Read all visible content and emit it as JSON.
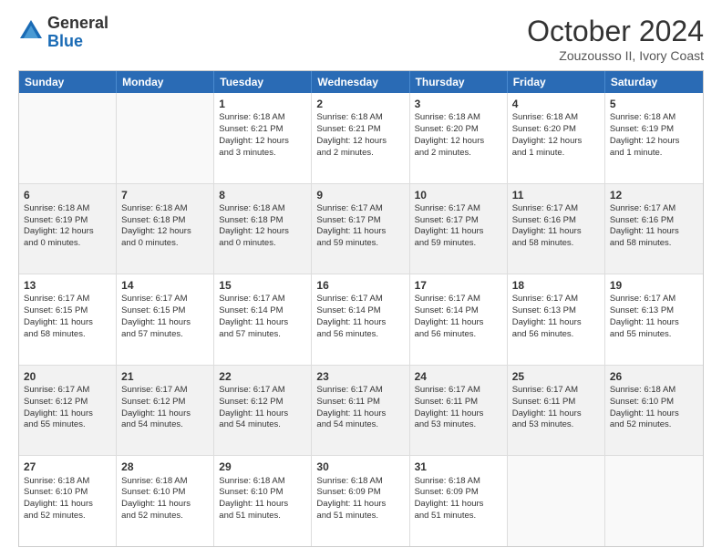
{
  "logo": {
    "general": "General",
    "blue": "Blue"
  },
  "title": "October 2024",
  "location": "Zouzousso II, Ivory Coast",
  "headers": [
    "Sunday",
    "Monday",
    "Tuesday",
    "Wednesday",
    "Thursday",
    "Friday",
    "Saturday"
  ],
  "weeks": [
    [
      {
        "day": "",
        "info": ""
      },
      {
        "day": "",
        "info": ""
      },
      {
        "day": "1",
        "info": "Sunrise: 6:18 AM\nSunset: 6:21 PM\nDaylight: 12 hours\nand 3 minutes."
      },
      {
        "day": "2",
        "info": "Sunrise: 6:18 AM\nSunset: 6:21 PM\nDaylight: 12 hours\nand 2 minutes."
      },
      {
        "day": "3",
        "info": "Sunrise: 6:18 AM\nSunset: 6:20 PM\nDaylight: 12 hours\nand 2 minutes."
      },
      {
        "day": "4",
        "info": "Sunrise: 6:18 AM\nSunset: 6:20 PM\nDaylight: 12 hours\nand 1 minute."
      },
      {
        "day": "5",
        "info": "Sunrise: 6:18 AM\nSunset: 6:19 PM\nDaylight: 12 hours\nand 1 minute."
      }
    ],
    [
      {
        "day": "6",
        "info": "Sunrise: 6:18 AM\nSunset: 6:19 PM\nDaylight: 12 hours\nand 0 minutes."
      },
      {
        "day": "7",
        "info": "Sunrise: 6:18 AM\nSunset: 6:18 PM\nDaylight: 12 hours\nand 0 minutes."
      },
      {
        "day": "8",
        "info": "Sunrise: 6:18 AM\nSunset: 6:18 PM\nDaylight: 12 hours\nand 0 minutes."
      },
      {
        "day": "9",
        "info": "Sunrise: 6:17 AM\nSunset: 6:17 PM\nDaylight: 11 hours\nand 59 minutes."
      },
      {
        "day": "10",
        "info": "Sunrise: 6:17 AM\nSunset: 6:17 PM\nDaylight: 11 hours\nand 59 minutes."
      },
      {
        "day": "11",
        "info": "Sunrise: 6:17 AM\nSunset: 6:16 PM\nDaylight: 11 hours\nand 58 minutes."
      },
      {
        "day": "12",
        "info": "Sunrise: 6:17 AM\nSunset: 6:16 PM\nDaylight: 11 hours\nand 58 minutes."
      }
    ],
    [
      {
        "day": "13",
        "info": "Sunrise: 6:17 AM\nSunset: 6:15 PM\nDaylight: 11 hours\nand 58 minutes."
      },
      {
        "day": "14",
        "info": "Sunrise: 6:17 AM\nSunset: 6:15 PM\nDaylight: 11 hours\nand 57 minutes."
      },
      {
        "day": "15",
        "info": "Sunrise: 6:17 AM\nSunset: 6:14 PM\nDaylight: 11 hours\nand 57 minutes."
      },
      {
        "day": "16",
        "info": "Sunrise: 6:17 AM\nSunset: 6:14 PM\nDaylight: 11 hours\nand 56 minutes."
      },
      {
        "day": "17",
        "info": "Sunrise: 6:17 AM\nSunset: 6:14 PM\nDaylight: 11 hours\nand 56 minutes."
      },
      {
        "day": "18",
        "info": "Sunrise: 6:17 AM\nSunset: 6:13 PM\nDaylight: 11 hours\nand 56 minutes."
      },
      {
        "day": "19",
        "info": "Sunrise: 6:17 AM\nSunset: 6:13 PM\nDaylight: 11 hours\nand 55 minutes."
      }
    ],
    [
      {
        "day": "20",
        "info": "Sunrise: 6:17 AM\nSunset: 6:12 PM\nDaylight: 11 hours\nand 55 minutes."
      },
      {
        "day": "21",
        "info": "Sunrise: 6:17 AM\nSunset: 6:12 PM\nDaylight: 11 hours\nand 54 minutes."
      },
      {
        "day": "22",
        "info": "Sunrise: 6:17 AM\nSunset: 6:12 PM\nDaylight: 11 hours\nand 54 minutes."
      },
      {
        "day": "23",
        "info": "Sunrise: 6:17 AM\nSunset: 6:11 PM\nDaylight: 11 hours\nand 54 minutes."
      },
      {
        "day": "24",
        "info": "Sunrise: 6:17 AM\nSunset: 6:11 PM\nDaylight: 11 hours\nand 53 minutes."
      },
      {
        "day": "25",
        "info": "Sunrise: 6:17 AM\nSunset: 6:11 PM\nDaylight: 11 hours\nand 53 minutes."
      },
      {
        "day": "26",
        "info": "Sunrise: 6:18 AM\nSunset: 6:10 PM\nDaylight: 11 hours\nand 52 minutes."
      }
    ],
    [
      {
        "day": "27",
        "info": "Sunrise: 6:18 AM\nSunset: 6:10 PM\nDaylight: 11 hours\nand 52 minutes."
      },
      {
        "day": "28",
        "info": "Sunrise: 6:18 AM\nSunset: 6:10 PM\nDaylight: 11 hours\nand 52 minutes."
      },
      {
        "day": "29",
        "info": "Sunrise: 6:18 AM\nSunset: 6:10 PM\nDaylight: 11 hours\nand 51 minutes."
      },
      {
        "day": "30",
        "info": "Sunrise: 6:18 AM\nSunset: 6:09 PM\nDaylight: 11 hours\nand 51 minutes."
      },
      {
        "day": "31",
        "info": "Sunrise: 6:18 AM\nSunset: 6:09 PM\nDaylight: 11 hours\nand 51 minutes."
      },
      {
        "day": "",
        "info": ""
      },
      {
        "day": "",
        "info": ""
      }
    ]
  ]
}
